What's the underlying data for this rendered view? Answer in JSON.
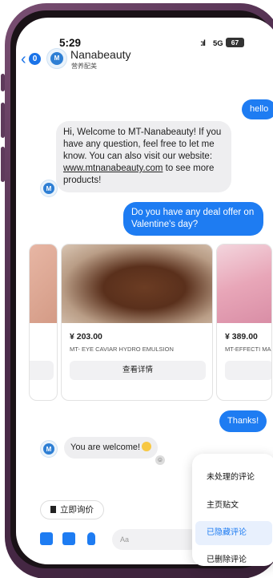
{
  "status_bar": {
    "time": "5:29",
    "signal": ":ıl",
    "network": "5G",
    "battery": "67"
  },
  "header": {
    "back_symbol": "‹",
    "unread_count": "0",
    "avatar_text": "M",
    "name": "Nanabeauty",
    "subtitle": "营养配美"
  },
  "messages": [
    {
      "from": "user",
      "text": "hello"
    },
    {
      "from": "page",
      "text_before_link": "Hi, Welcome to MT-Nanabeauty! If you have any question, feel free to let me know. You can also visit our website: ",
      "link": "www.mtnanabeauty.com",
      "text_after_link": " to see more products!"
    },
    {
      "from": "user",
      "text": "Do you have any deal offer on Valentine's day?"
    },
    {
      "from": "user",
      "text": "Thanks!"
    },
    {
      "from": "page",
      "text": "You are welcome!"
    }
  ],
  "carousel": [
    {
      "price": "",
      "name": "",
      "button": ""
    },
    {
      "price": "¥ 203.00",
      "name": "MT- EYE CAVIAR HYDRO EMULSION",
      "button": "查看详情"
    },
    {
      "price": "¥ 389.00",
      "name": "MT-EFFECTI MAKEUP RE",
      "button": ""
    }
  ],
  "quick_reply": {
    "label": "立即询价"
  },
  "composer": {
    "placeholder": "Aa",
    "icons": [
      "camera-icon",
      "photo-icon",
      "mic-icon"
    ]
  },
  "context_menu": {
    "items": [
      "未处理的评论",
      "主页贴文",
      "已隐藏评论",
      "已删除评论"
    ],
    "active_index": 2
  },
  "colors": {
    "accent": "#1e7cf2",
    "frame": "#4d2c4c",
    "incoming_bubble": "#eeeef0"
  }
}
